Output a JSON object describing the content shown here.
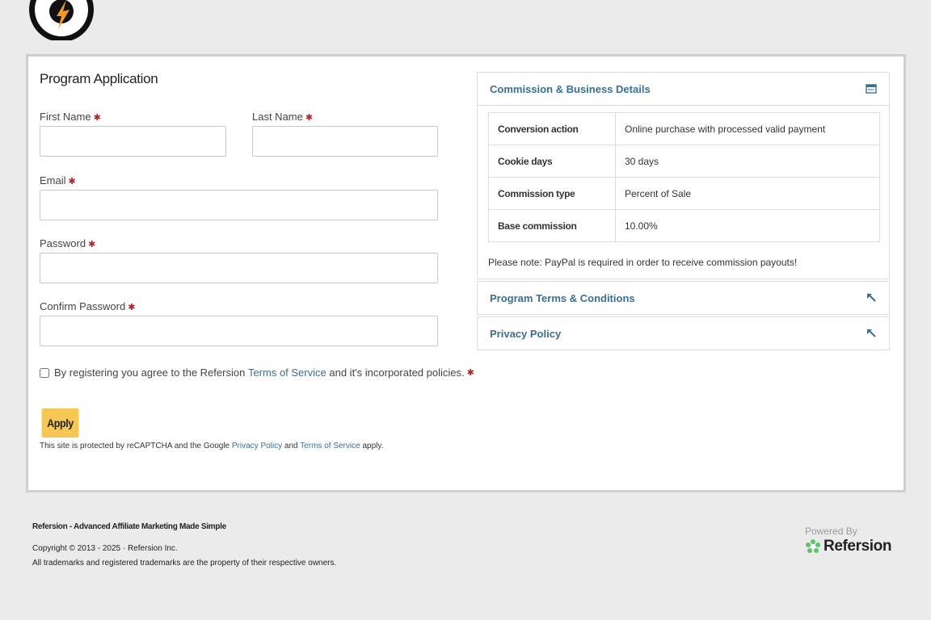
{
  "form": {
    "title": "Program Application",
    "first_name_label": "First Name",
    "last_name_label": "Last Name",
    "email_label": "Email",
    "password_label": "Password",
    "confirm_password_label": "Confirm Password",
    "required_marker": "✱",
    "terms_prefix": "By registering you agree to the Refersion ",
    "terms_link": "Terms of Service",
    "terms_suffix": " and it's incorporated policies.",
    "apply_label": "Apply",
    "recaptcha_prefix": "This site is protected by reCAPTCHA and the Google ",
    "recaptcha_privacy": "Privacy Policy",
    "recaptcha_and": " and ",
    "recaptcha_terms": "Terms of Service",
    "recaptcha_suffix": " apply."
  },
  "details": {
    "title": "Commission & Business Details",
    "rows": [
      {
        "key": "Conversion action",
        "value": "Online purchase with processed valid payment"
      },
      {
        "key": "Cookie days",
        "value": "30 days"
      },
      {
        "key": "Commission type",
        "value": "Percent of Sale"
      },
      {
        "key": "Base commission",
        "value": "10.00%"
      }
    ],
    "note": "Please note: PayPal is required in order to receive commission payouts!"
  },
  "panels": {
    "terms_title": "Program Terms & Conditions",
    "privacy_title": "Privacy Policy"
  },
  "footer": {
    "tagline": "Refersion - Advanced Affiliate Marketing Made Simple",
    "copyright": "Copyright © 2013 - 2025 · Refersion Inc.",
    "trademarks": "All trademarks and registered trademarks are the property of their respective owners.",
    "powered_by": "Powered By",
    "brand": "Refersion"
  },
  "icons": {
    "details": "card-icon",
    "terms": "external-link-icon",
    "privacy": "external-link-icon"
  },
  "colors": {
    "accent": "#3a6f94",
    "apply_button": "#f6c755",
    "required": "#b22222",
    "brand_green": "#5fc36b"
  }
}
